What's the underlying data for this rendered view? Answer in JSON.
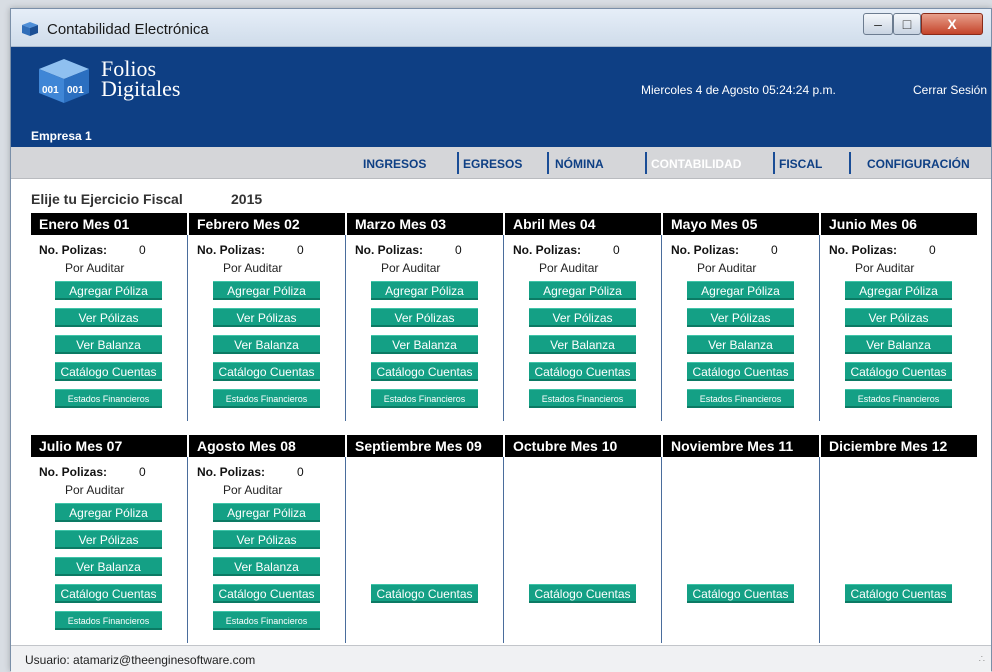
{
  "window": {
    "title": "Contabilidad Electrónica"
  },
  "header": {
    "brand_line1": "Folios",
    "brand_line2": "Digitales",
    "datetime": "Miercoles 4 de Agosto 05:24:24 p.m.",
    "logout_label": "Cerrar Sesión",
    "company": "Empresa 1"
  },
  "nav": {
    "items": [
      "INGRESOS",
      "EGRESOS",
      "NÓMINA",
      "CONTABILIDAD",
      "FISCAL",
      "CONFIGURACIÓN"
    ],
    "active": "CONTABILIDAD"
  },
  "fiscal": {
    "label": "Elije tu Ejercicio Fiscal",
    "year": "2015"
  },
  "labels": {
    "polizas": "No. Polizas:",
    "status": "Por Auditar",
    "agregar": "Agregar Póliza",
    "ver_polizas": "Ver Pólizas",
    "ver_balanza": "Ver Balanza",
    "catalogo": "Catálogo Cuentas",
    "estados": "Estados Financieros"
  },
  "months": [
    {
      "name": "Enero Mes 01",
      "polizas": "0"
    },
    {
      "name": "Febrero Mes 02",
      "polizas": "0"
    },
    {
      "name": "Marzo Mes 03",
      "polizas": "0"
    },
    {
      "name": "Abril Mes 04",
      "polizas": "0"
    },
    {
      "name": "Mayo Mes 05",
      "polizas": "0"
    },
    {
      "name": "Junio Mes 06",
      "polizas": "0"
    },
    {
      "name": "Julio Mes 07",
      "polizas": "0"
    },
    {
      "name": "Agosto Mes 08",
      "polizas": "0"
    },
    {
      "name": "Septiembre Mes 09",
      "polizas": null
    },
    {
      "name": "Octubre Mes 10",
      "polizas": null
    },
    {
      "name": "Noviembre Mes 11",
      "polizas": null
    },
    {
      "name": "Diciembre Mes 12",
      "polizas": null
    }
  ],
  "status_bar": {
    "user": "Usuario: atamariz@theenginesoftware.com"
  },
  "colors": {
    "header_bg": "#0e3f84",
    "button_bg": "#14a085",
    "month_head_bg": "#000000"
  }
}
